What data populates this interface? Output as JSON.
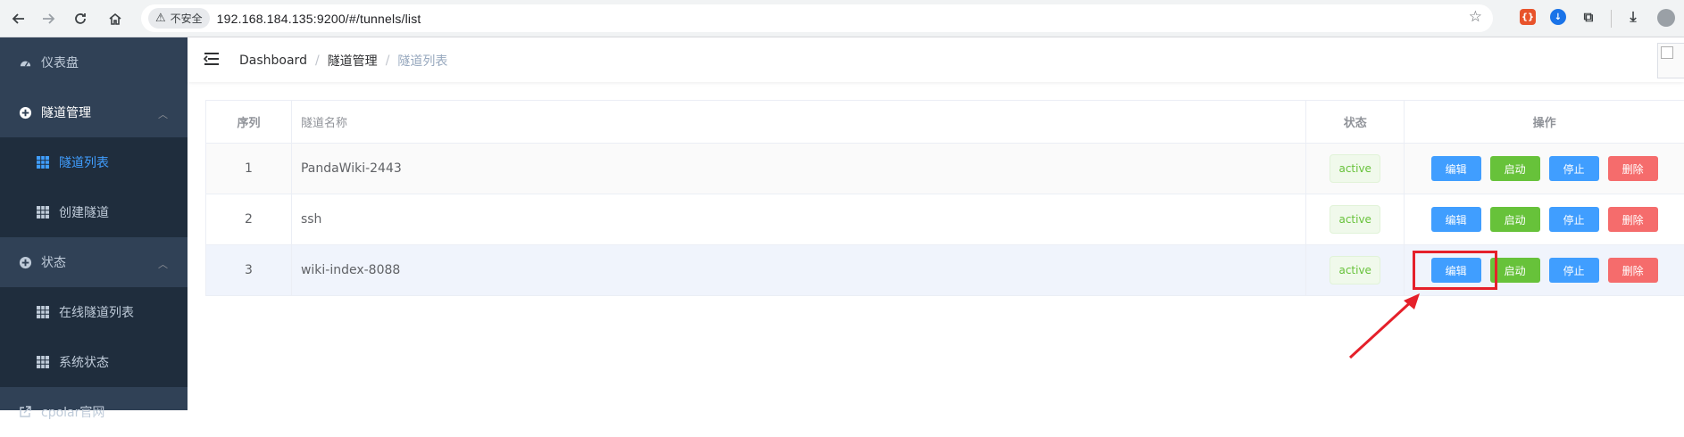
{
  "browser": {
    "insecure_label": "不安全",
    "url": "192.168.184.135:9200/#/tunnels/list",
    "icons": [
      "back-icon",
      "forward-icon",
      "reload-icon",
      "home-icon",
      "warning-icon",
      "star-icon",
      "extension-icon",
      "download-icon",
      "profile-icon"
    ]
  },
  "sidebar": {
    "items": [
      {
        "label": "仪表盘",
        "icon": "dashboard-icon"
      },
      {
        "label": "隧道管理",
        "icon": "circle-plus-icon"
      },
      {
        "label": "隧道列表",
        "icon": "grid-icon",
        "active": true
      },
      {
        "label": "创建隧道",
        "icon": "grid-icon"
      },
      {
        "label": "状态",
        "icon": "circle-plus-icon"
      },
      {
        "label": "在线隧道列表",
        "icon": "grid-icon"
      },
      {
        "label": "系统状态",
        "icon": "grid-icon"
      },
      {
        "label": "cpolar官网",
        "icon": "external-link-icon"
      }
    ]
  },
  "breadcrumb": [
    "Dashboard",
    "隧道管理",
    "隧道列表"
  ],
  "table": {
    "headers": [
      "序列",
      "隧道名称",
      "状态",
      "操作"
    ],
    "rows": [
      {
        "index": "1",
        "name": "PandaWiki-2443",
        "status": "active"
      },
      {
        "index": "2",
        "name": "ssh",
        "status": "active"
      },
      {
        "index": "3",
        "name": "wiki-index-8088",
        "status": "active"
      }
    ],
    "actions": {
      "edit": "编辑",
      "start": "启动",
      "stop": "停止",
      "delete": "删除"
    }
  },
  "colors": {
    "sidebar_bg": "#304156",
    "sidebar_sub_bg": "#1f2d3d",
    "accent": "#409eff",
    "success": "#67c23a",
    "danger": "#f56c6c",
    "annotation": "#e5202a"
  }
}
